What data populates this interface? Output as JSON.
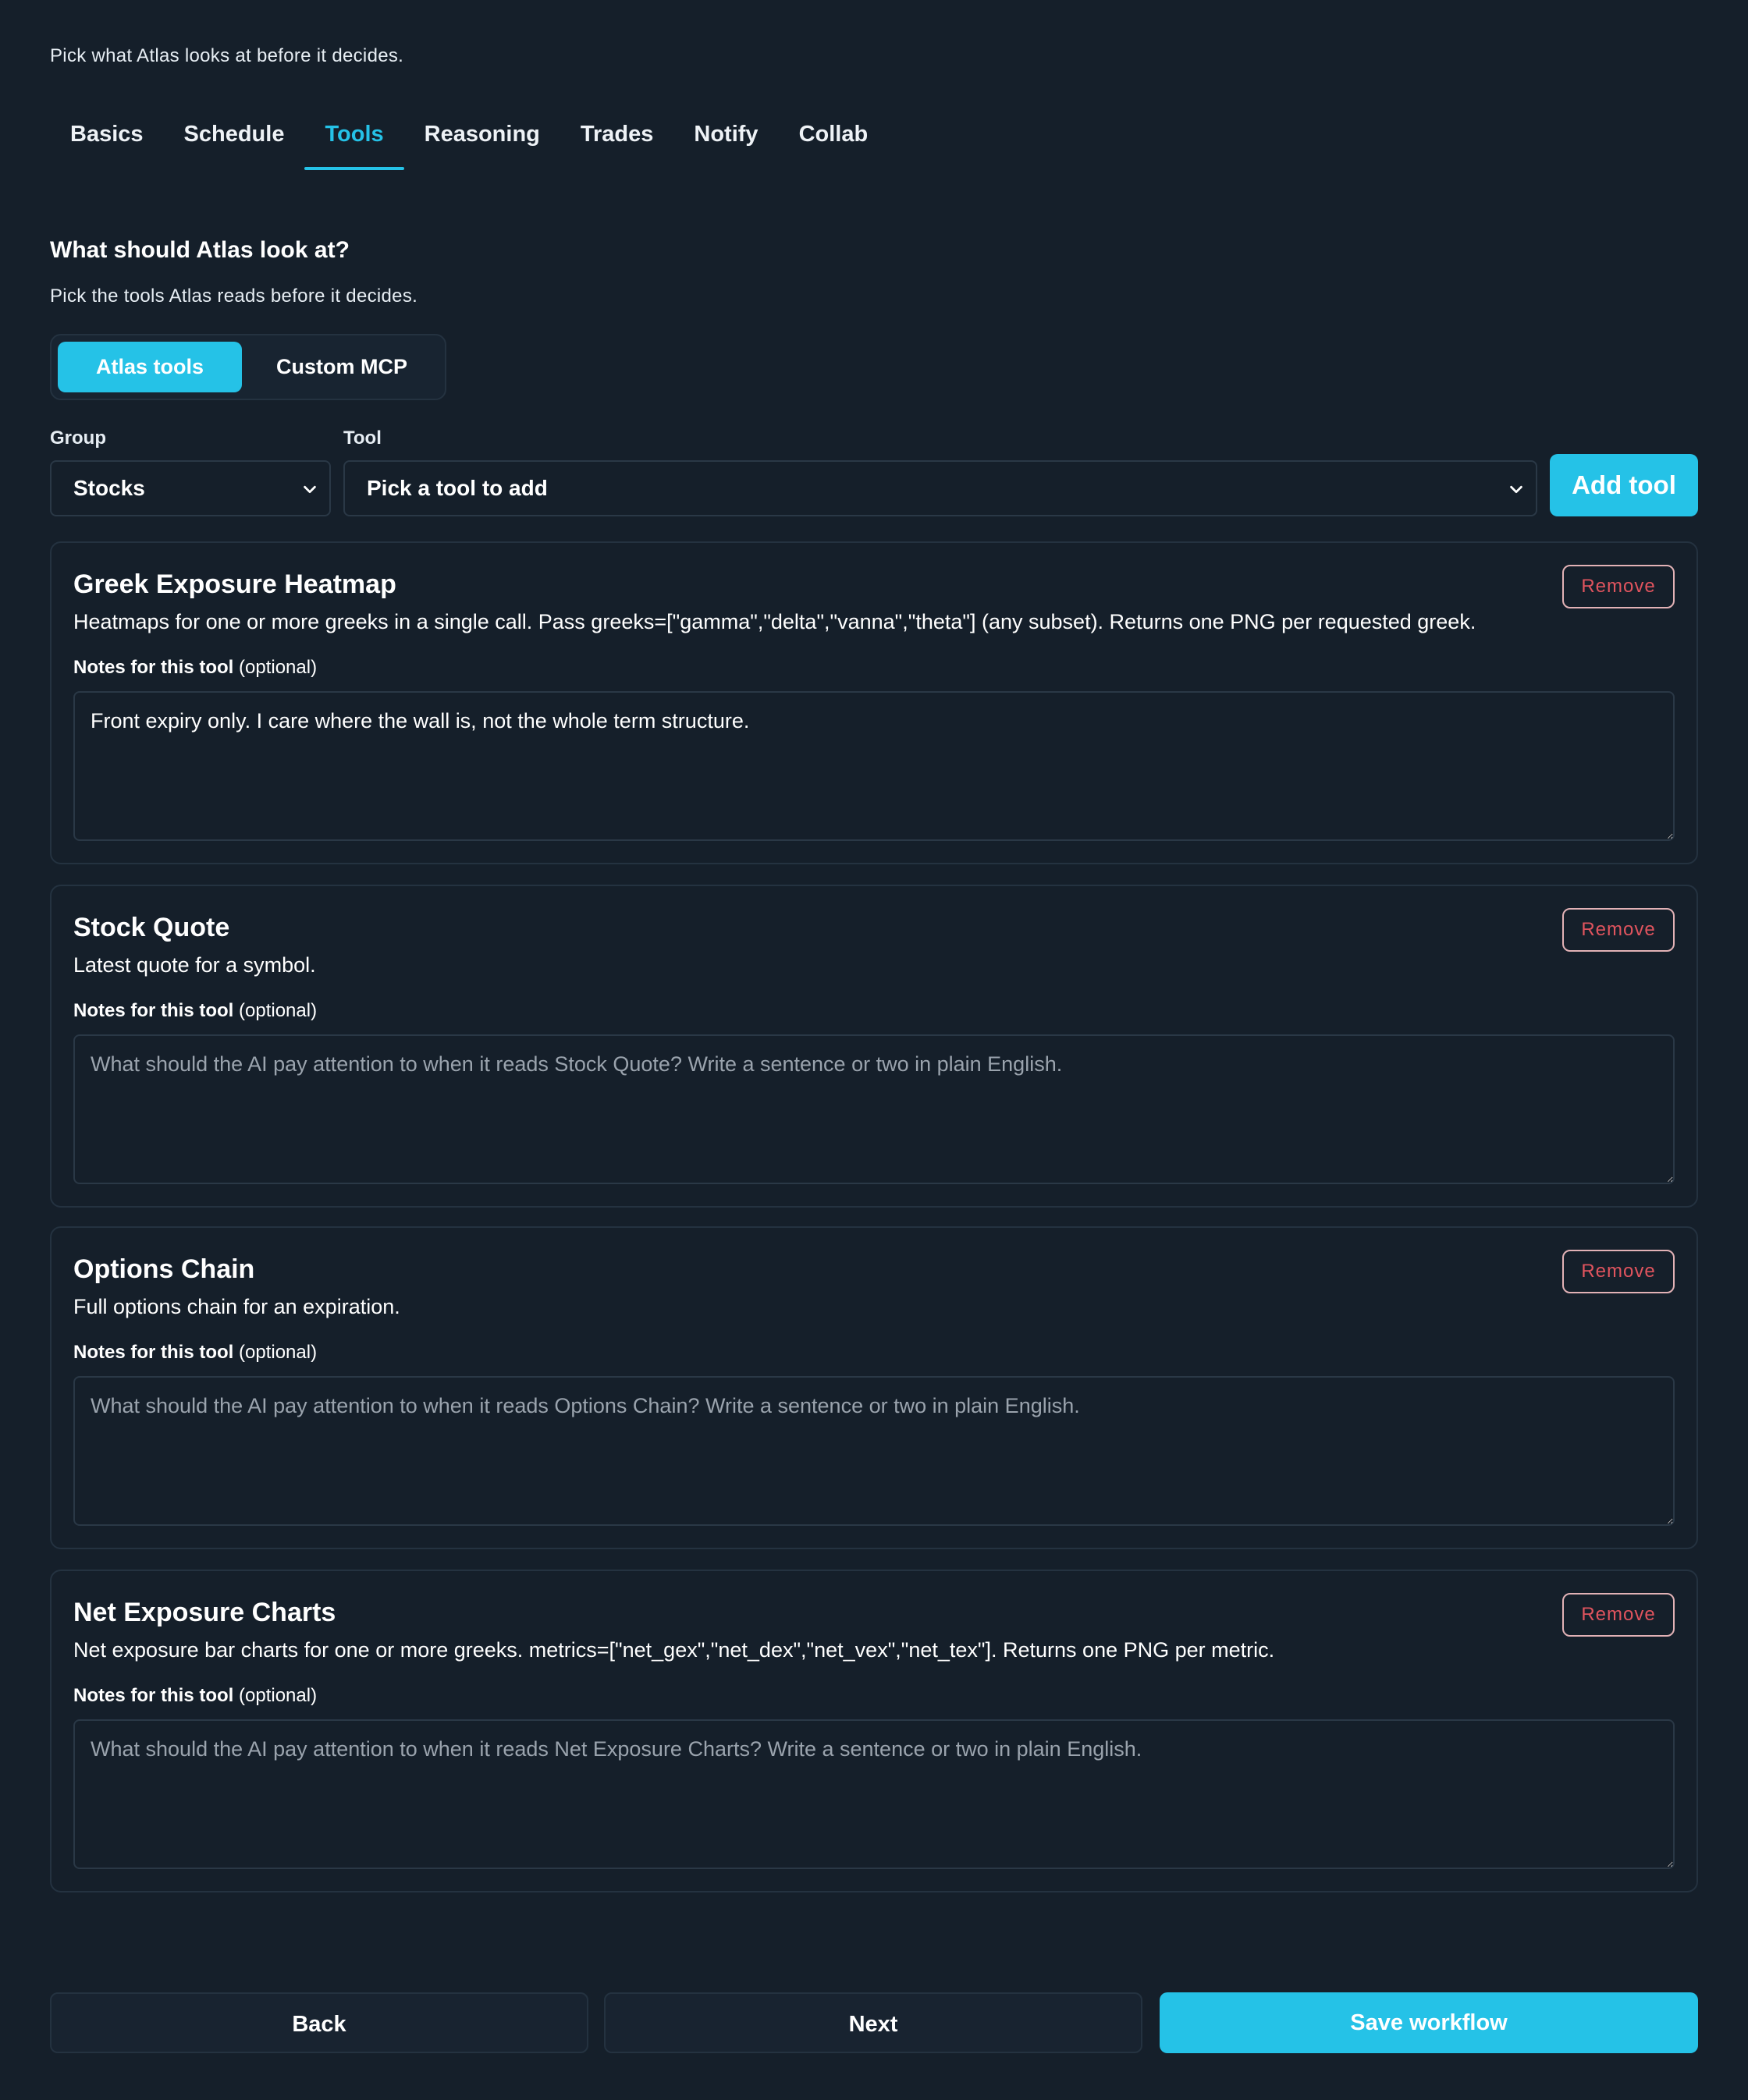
{
  "intro": "Pick what Atlas looks at before it decides.",
  "tabs": [
    {
      "label": "Basics"
    },
    {
      "label": "Schedule"
    },
    {
      "label": "Tools"
    },
    {
      "label": "Reasoning"
    },
    {
      "label": "Trades"
    },
    {
      "label": "Notify"
    },
    {
      "label": "Collab"
    }
  ],
  "active_tab": "Tools",
  "section": {
    "title": "What should Atlas look at?",
    "subtitle": "Pick the tools Atlas reads before it decides."
  },
  "source_toggle": {
    "options": [
      "Atlas tools",
      "Custom MCP"
    ],
    "selected": "Atlas tools"
  },
  "picker": {
    "group_label": "Group",
    "group_value": "Stocks",
    "tool_label": "Tool",
    "tool_value": "Pick a tool to add",
    "add_label": "Add tool"
  },
  "tools": [
    {
      "title": "Greek Exposure Heatmap",
      "description": "Heatmaps for one or more greeks in a single call. Pass greeks=[\"gamma\",\"delta\",\"vanna\",\"theta\"] (any subset). Returns one PNG per requested greek.",
      "remove_label": "Remove",
      "notes_label": "Notes for this tool",
      "notes_optional": "(optional)",
      "notes_value": "Front expiry only. I care where the wall is, not the whole term structure.",
      "notes_placeholder": "What should the AI pay attention to when it reads Greek Exposure Heatmap? Write a sentence or two in plain English."
    },
    {
      "title": "Stock Quote",
      "description": "Latest quote for a symbol.",
      "remove_label": "Remove",
      "notes_label": "Notes for this tool",
      "notes_optional": "(optional)",
      "notes_value": "",
      "notes_placeholder": "What should the AI pay attention to when it reads Stock Quote? Write a sentence or two in plain English."
    },
    {
      "title": "Options Chain",
      "description": "Full options chain for an expiration.",
      "remove_label": "Remove",
      "notes_label": "Notes for this tool",
      "notes_optional": "(optional)",
      "notes_value": "",
      "notes_placeholder": "What should the AI pay attention to when it reads Options Chain? Write a sentence or two in plain English."
    },
    {
      "title": "Net Exposure Charts",
      "description": "Net exposure bar charts for one or more greeks. metrics=[\"net_gex\",\"net_dex\",\"net_vex\",\"net_tex\"]. Returns one PNG per metric.",
      "remove_label": "Remove",
      "notes_label": "Notes for this tool",
      "notes_optional": "(optional)",
      "notes_value": "",
      "notes_placeholder": "What should the AI pay attention to when it reads Net Exposure Charts? Write a sentence or two in plain English."
    }
  ],
  "footer": {
    "back_label": "Back",
    "next_label": "Next",
    "save_label": "Save workflow"
  },
  "colors": {
    "background": "#151f2a",
    "accent": "#25c2e7",
    "danger": "#e0545e"
  }
}
